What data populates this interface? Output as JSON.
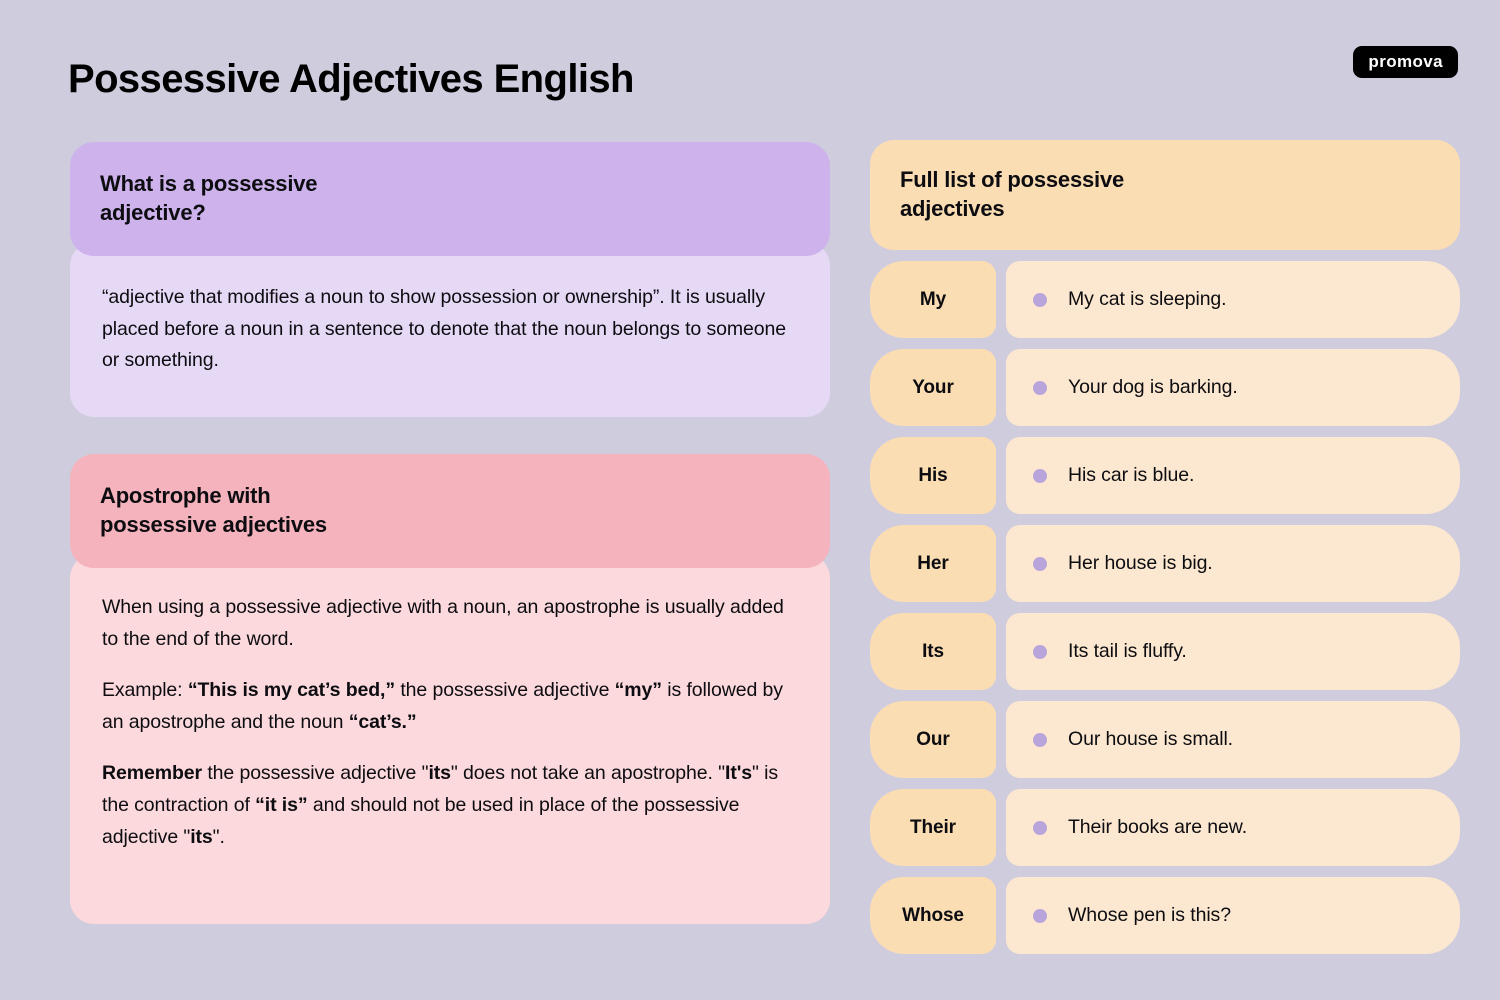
{
  "page": {
    "title": "Possessive Adjectives English",
    "brand": "promova",
    "colors": {
      "background": "#cfccdd",
      "purple_header": "#cdb2ec",
      "purple_body": "#e6d9f5",
      "pink_header": "#f5b3bd",
      "pink_body": "#fbd9dd",
      "peach_dark": "#fbddb3",
      "peach_light": "#fce8d0",
      "bullet": "#b9a5d9"
    }
  },
  "definition_card": {
    "header": "What is a  possessive\nadjective?",
    "body": "“adjective that modifies a noun to show possession or ownership”. It is usually placed before a noun in a sentence to denote that the noun belongs to someone or something."
  },
  "apostrophe_card": {
    "header": "Apostrophe with\npossessive adjectives",
    "paragraphs": [
      {
        "parts": [
          {
            "text": "When using a possessive adjective with a noun, an apostrophe is usually added to the end of the word.",
            "bold": false
          }
        ]
      },
      {
        "parts": [
          {
            "text": "Example: ",
            "bold": false
          },
          {
            "text": "“This is my cat’s bed,”",
            "bold": true
          },
          {
            "text": " the possessive adjective ",
            "bold": false
          },
          {
            "text": "“my”",
            "bold": true
          },
          {
            "text": " is followed by an apostrophe and the noun ",
            "bold": false
          },
          {
            "text": "“cat’s.”",
            "bold": true
          }
        ]
      },
      {
        "parts": [
          {
            "text": "Remember",
            "bold": true
          },
          {
            "text": "  the possessive adjective \"",
            "bold": false
          },
          {
            "text": "its",
            "bold": true
          },
          {
            "text": "\" does not take an apostrophe. \"",
            "bold": false
          },
          {
            "text": "It's",
            "bold": true
          },
          {
            "text": "\" is the contraction of ",
            "bold": false
          },
          {
            "text": "“it is”",
            "bold": true
          },
          {
            "text": " and should not be used in place of the possessive adjective \"",
            "bold": false
          },
          {
            "text": "its",
            "bold": true
          },
          {
            "text": "\".",
            "bold": false
          }
        ]
      }
    ]
  },
  "list_card": {
    "header": "Full list of possessive\nadjectives",
    "rows": [
      {
        "word": "My",
        "example": "My cat is sleeping."
      },
      {
        "word": "Your",
        "example": "Your dog is barking."
      },
      {
        "word": "His",
        "example": "His car is blue."
      },
      {
        "word": "Her",
        "example": "Her house is big."
      },
      {
        "word": "Its",
        "example": "Its tail is fluffy."
      },
      {
        "word": "Our",
        "example": "Our house is small."
      },
      {
        "word": "Their",
        "example": "Their books are new."
      },
      {
        "word": "Whose",
        "example": "Whose pen is this?"
      }
    ]
  }
}
